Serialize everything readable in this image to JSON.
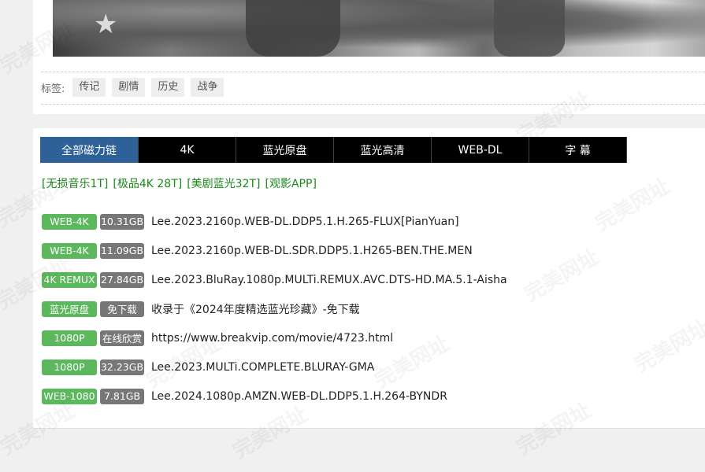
{
  "tags": {
    "label": "标签:",
    "items": [
      "传记",
      "剧情",
      "历史",
      "战争"
    ]
  },
  "tabs": [
    "全部磁力链",
    "4K",
    "蓝光原盘",
    "蓝光高清",
    "WEB-DL",
    "字 幕"
  ],
  "promo": [
    "[无损音乐1T]",
    "[极品4K 28T]",
    "[美剧蓝光32T]",
    "[观影APP]"
  ],
  "downloads": [
    {
      "quality": "WEB-4K",
      "size": "10.31GB",
      "title": "Lee.2023.2160p.WEB-DL.DDP5.1.H.265-FLUX[PianYuan]"
    },
    {
      "quality": "WEB-4K",
      "size": "11.09GB",
      "title": "Lee.2023.2160p.WEB-DL.SDR.DDP5.1.H265-BEN.THE.MEN"
    },
    {
      "quality": "4K REMUX",
      "size": "27.84GB",
      "title": "Lee.2023.BluRay.1080p.MULTi.REMUX.AVC.DTS-HD.MA.5.1-Aisha"
    },
    {
      "quality": "蓝光原盘",
      "size": "免下载",
      "title": "收录于《2024年度精选蓝光珍藏》-免下载"
    },
    {
      "quality": "1080P",
      "size": "在线欣赏",
      "title": "https://www.breakvip.com/movie/4723.html"
    },
    {
      "quality": "1080P",
      "size": "32.23GB",
      "title": "Lee.2023.MULTi.COMPLETE.BLURAY-GMA"
    },
    {
      "quality": "WEB-1080",
      "size": "7.81GB",
      "title": "Lee.2024.1080p.AMZN.WEB-DL.DDP5.1.H.264-BYNDR"
    }
  ],
  "watermark": "完美网址",
  "colors": {
    "tab_active": "#2d6197",
    "tab": "#000000",
    "quality_badge": "#5cb85c",
    "size_badge": "#777777",
    "promo_link": "#1a8a1a"
  }
}
